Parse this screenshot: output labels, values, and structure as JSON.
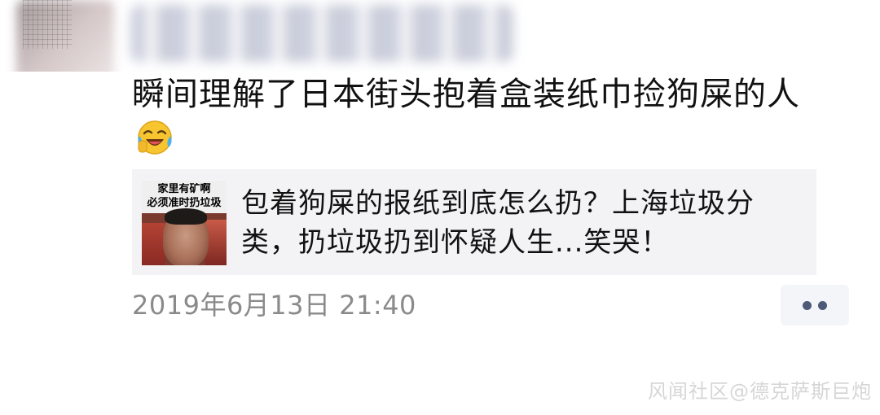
{
  "post": {
    "text": "瞬间理解了日本街头抱着盒装纸巾捡狗屎的人",
    "emoji": "crying-laughing-emoji",
    "timestamp": "2019年6月13日 21:40"
  },
  "link_card": {
    "thumbnail_caption_line1": "家里有矿啊",
    "thumbnail_caption_line2": "必须准时扔垃圾",
    "title": "包着狗屎的报纸到底怎么扔？上海垃圾分类，扔垃圾扔到怀疑人生...笑哭！"
  },
  "actions": {
    "more_icon": "more-dots-icon"
  },
  "watermark": {
    "text": "风闻社区@德克萨斯巨炮"
  }
}
